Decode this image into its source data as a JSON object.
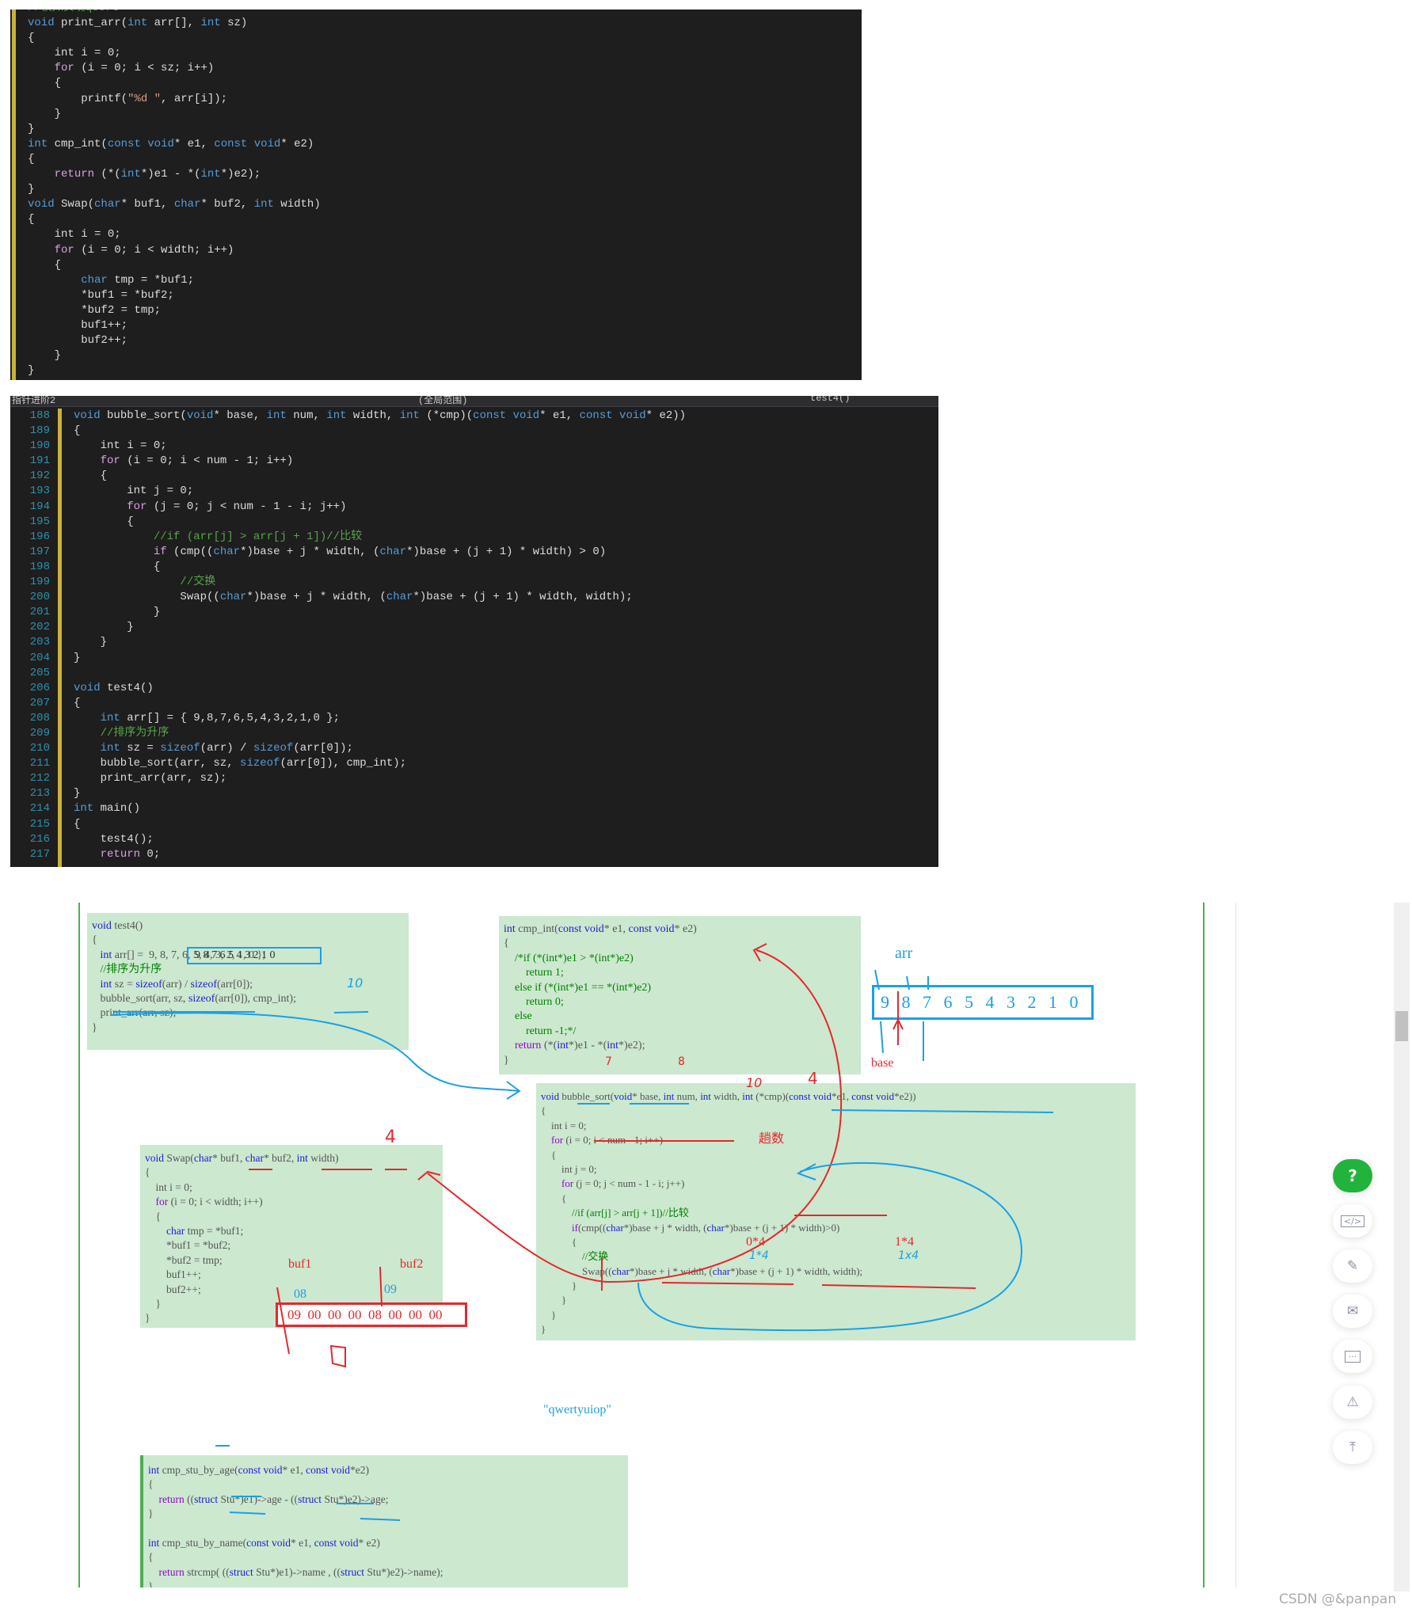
{
  "panel1": {
    "lines": [
      "//模拟实现qsort",
      "void print_arr(int arr[], int sz)",
      "{",
      "    int i = 0;",
      "    for (i = 0; i < sz; i++)",
      "    {",
      "        printf(\"%d \", arr[i]);",
      "    }",
      "}",
      "int cmp_int(const void* e1, const void* e2)",
      "{",
      "    return (*(int*)e1 - *(int*)e2);",
      "}",
      "void Swap(char* buf1, char* buf2, int width)",
      "{",
      "    int i = 0;",
      "    for (i = 0; i < width; i++)",
      "    {",
      "        char tmp = *buf1;",
      "        *buf1 = *buf2;",
      "        *buf2 = tmp;",
      "        buf1++;",
      "        buf2++;",
      "    }",
      "}"
    ]
  },
  "panel2": {
    "tabs": [
      "指针进阶2",
      "(全局范围)",
      "test4()"
    ],
    "line_numbers": [
      "188",
      "189",
      "190",
      "191",
      "192",
      "193",
      "194",
      "195",
      "196",
      "197",
      "198",
      "199",
      "200",
      "201",
      "202",
      "203",
      "204",
      "205",
      "206",
      "207",
      "208",
      "209",
      "210",
      "211",
      "212",
      "213",
      "214",
      "215",
      "216",
      "217"
    ],
    "lines": [
      "void bubble_sort(void* base, int num, int width, int (*cmp)(const void* e1, const void* e2))",
      "{",
      "    int i = 0;",
      "    for (i = 0; i < num - 1; i++)",
      "    {",
      "        int j = 0;",
      "        for (j = 0; j < num - 1 - i; j++)",
      "        {",
      "            //if (arr[j] > arr[j + 1])//比较",
      "            if (cmp((char*)base + j * width, (char*)base + (j + 1) * width) > 0)",
      "            {",
      "                //交换",
      "                Swap((char*)base + j * width, (char*)base + (j + 1) * width, width);",
      "            }",
      "        }",
      "    }",
      "}",
      "",
      "void test4()",
      "{",
      "    int arr[] = { 9,8,7,6,5,4,3,2,1,0 };",
      "    //排序为升序",
      "    int sz = sizeof(arr) / sizeof(arr[0]);",
      "    bubble_sort(arr, sz, sizeof(arr[0]), cmp_int);",
      "    print_arr(arr, sz);",
      "}",
      "int main()",
      "{",
      "    test4();",
      "    return 0;"
    ]
  },
  "notes": {
    "test4": [
      "void test4()",
      "{",
      "   int arr[] =  9, 8, 7, 6, 5, 4, 3, 2, 1, 0 };",
      "   //排序为升序",
      "   int sz = sizeof(arr) / sizeof(arr[0]);",
      "   bubble_sort(arr, sz, sizeof(arr[0]), cmp_int);",
      "   print_arr(arr, sz);",
      "}"
    ],
    "cmp_int": [
      "int cmp_int(const void* e1, const void* e2)",
      "{",
      "    /*if (*(int*)e1 > *(int*)e2)",
      "        return 1;",
      "    else if (*(int*)e1 == *(int*)e2)",
      "        return 0;",
      "    else",
      "        return -1;*/",
      "    return (*(int*)e1 - *(int*)e2);",
      "}"
    ],
    "bubble_sort": [
      "void bubble_sort(void* base, int num, int width, int (*cmp)(const void*e1, const void*e2))",
      "{",
      "    int i = 0;",
      "    for (i = 0; i < num - 1; i++)",
      "    {",
      "        int j = 0;",
      "        for (j = 0; j < num - 1 - i; j++)",
      "        {",
      "            //if (arr[j] > arr[j + 1])//比较",
      "            if(cmp((char*)base + j * width, (char*)base + (j + 1) * width)>0)",
      "            {",
      "                //交换",
      "                Swap((char*)base + j * width, (char*)base + (j + 1) * width, width);",
      "            }",
      "        }",
      "    }",
      "}"
    ],
    "swap": [
      "void Swap(char* buf1, char* buf2, int width)",
      "{",
      "    int i = 0;",
      "    for (i = 0; i < width; i++)",
      "    {",
      "        char tmp = *buf1;",
      "        *buf1 = *buf2;",
      "        *buf2 = tmp;",
      "        buf1++;",
      "        buf2++;",
      "    }",
      "}"
    ],
    "cmp_stu": [
      "int cmp_stu_by_age(const void* e1, const void*e2)",
      "{",
      "    return ((struct Stu*)e1)->age - ((struct Stu*)e2)->age;",
      "}",
      "",
      "int cmp_stu_by_name(const void* e1, const void* e2)",
      "{",
      "    return strcmp( ((struct Stu*)e1)->name , ((struct Stu*)e2)->name);",
      "}"
    ],
    "string_literal": "\"qwertyuiop\"",
    "arr_values": "9 8 7 6 5 4 3 2 1 0",
    "byte_values": "09  00  00  00  08  00  00  00",
    "hand": {
      "arr": "arr",
      "base": "base",
      "sz_ten": "10",
      "num_ten": "10",
      "width_four": "4",
      "swap_four": "4",
      "passes": "趟数",
      "off0": "0*4",
      "off1": "1*4",
      "off0b": "1*4",
      "off1b": "1x4",
      "buf1": "buf1",
      "buf2": "buf2",
      "b08": "08",
      "b09": "09",
      "v7": "7",
      "v8": "8"
    }
  },
  "sidebar_buttons": [
    {
      "icon": "help-icon",
      "label": "?"
    },
    {
      "icon": "code-icon"
    },
    {
      "icon": "edit-icon"
    },
    {
      "icon": "mail-icon"
    },
    {
      "icon": "comment-icon"
    },
    {
      "icon": "warning-icon"
    },
    {
      "icon": "back-to-top-icon"
    }
  ],
  "watermark": "CSDN @&panpan",
  "colors": {
    "accent_green": "#22b33c",
    "note_bg": "#cce8cf",
    "ink_red": "#e8262b",
    "ink_blue": "#1aa0e6"
  }
}
